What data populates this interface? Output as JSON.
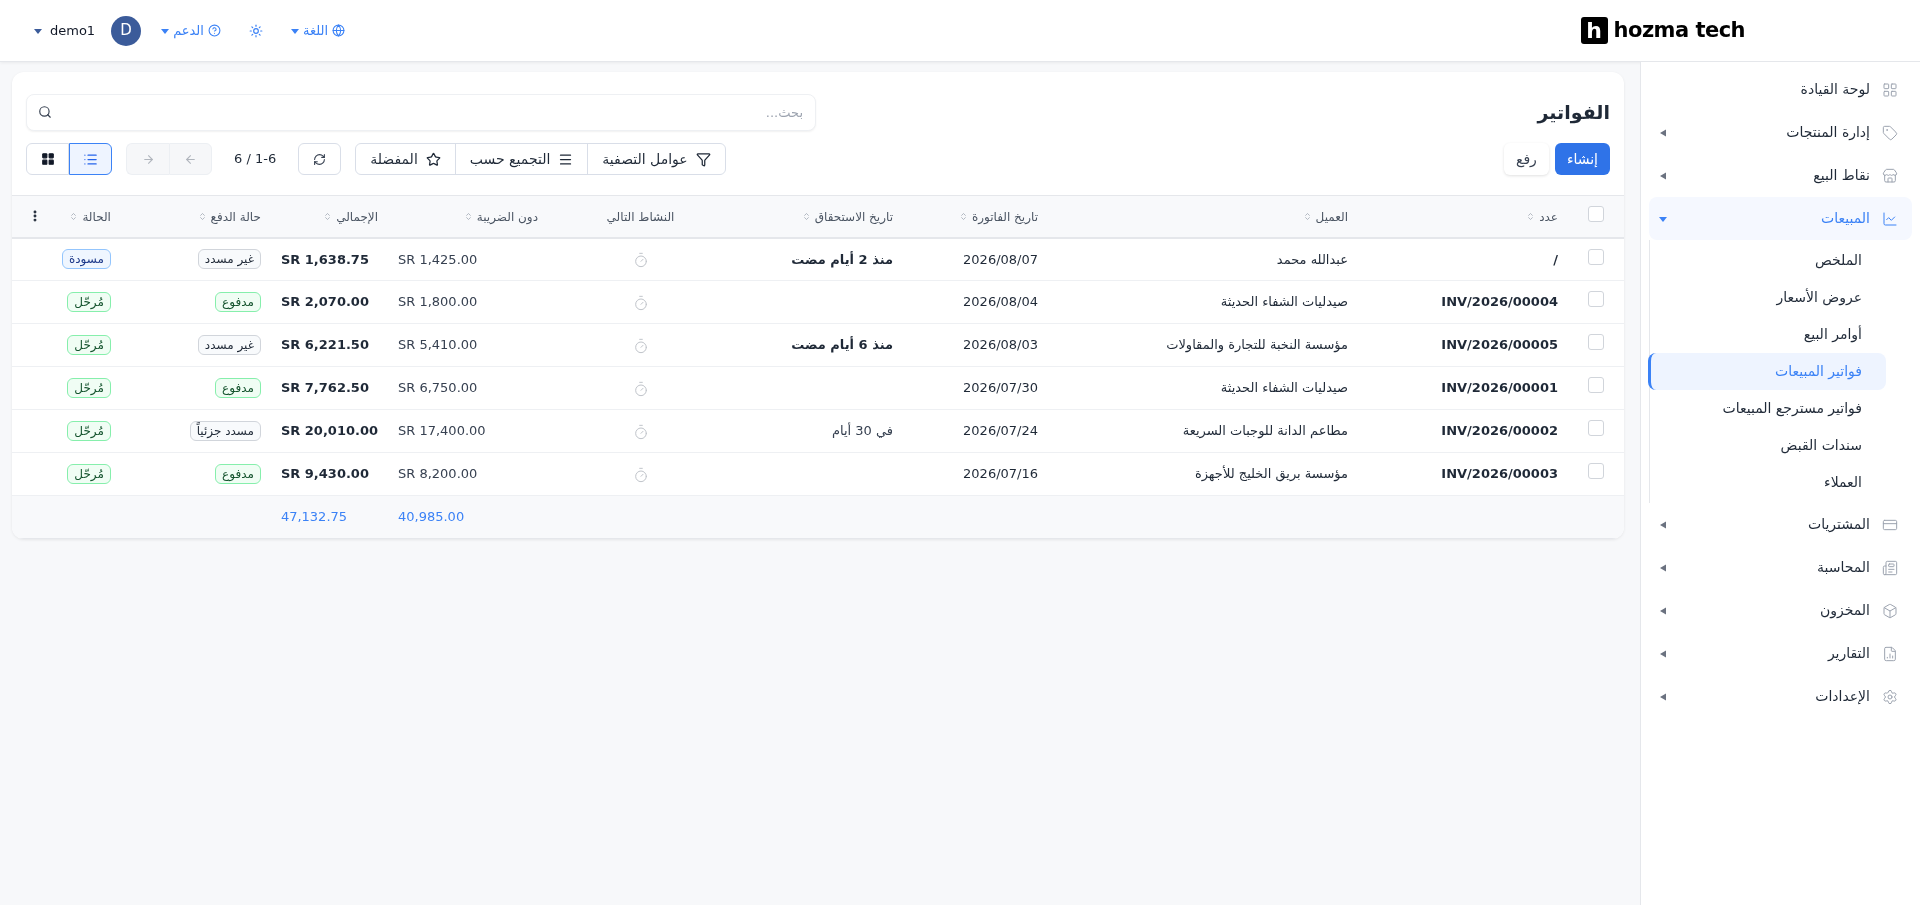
{
  "topbar": {
    "logo": {
      "mark": "h",
      "text": "hozma tech"
    },
    "menus": [
      {
        "kind": "language",
        "label": "اللغة"
      },
      {
        "kind": "theme"
      },
      {
        "kind": "support",
        "label": "الدعم"
      },
      {
        "kind": "user",
        "avatar": "D",
        "label": "demo1"
      }
    ]
  },
  "sidebar": {
    "items": [
      {
        "kind": "grid",
        "label": "لوحة القيادة",
        "expandable": false,
        "expanded": false
      },
      {
        "kind": "tag",
        "label": "إدارة المنتجات",
        "expandable": true,
        "expanded": false
      },
      {
        "kind": "store",
        "label": "نقاط البيع",
        "expandable": true,
        "expanded": false
      },
      {
        "kind": "chart",
        "label": "المبيعات",
        "expandable": true,
        "expanded": true,
        "children": [
          {
            "label": "الملخص",
            "selected": false
          },
          {
            "label": "عروض الأسعار",
            "selected": false
          },
          {
            "label": "أوامر البيع",
            "selected": false
          },
          {
            "label": "فواتير المبيعات",
            "selected": true
          },
          {
            "label": "فواتير مسترجع المبيعات",
            "selected": false
          },
          {
            "label": "سندات القبض",
            "selected": false
          },
          {
            "label": "العملاء",
            "selected": false
          }
        ]
      },
      {
        "kind": "wallet",
        "label": "المشتريات",
        "expandable": true,
        "expanded": false
      },
      {
        "kind": "ledger",
        "label": "المحاسبة",
        "expandable": true,
        "expanded": false
      },
      {
        "kind": "box",
        "label": "المخزون",
        "expandable": true,
        "expanded": false
      },
      {
        "kind": "report",
        "label": "التقارير",
        "expandable": true,
        "expanded": false
      },
      {
        "kind": "settings",
        "label": "الإعدادات",
        "expandable": true,
        "expanded": false
      }
    ]
  },
  "page": {
    "title": "الفواتير",
    "search": {
      "placeholder": "بحث..."
    },
    "actions": [
      {
        "kind": "primary",
        "label": "إنشاء"
      },
      {
        "kind": "secondary",
        "label": "رفع"
      }
    ],
    "filters": [
      {
        "kind": "filter",
        "label": "عوامل التصفية"
      },
      {
        "kind": "group",
        "label": "التجميع حسب"
      },
      {
        "kind": "favorites",
        "label": "المفضلة"
      }
    ],
    "pager": {
      "text": "6 / 1-6",
      "next_disabled": true,
      "prev_disabled": true
    },
    "views": [
      {
        "kind": "list",
        "selected": true
      },
      {
        "kind": "grid",
        "selected": false
      }
    ]
  },
  "table": {
    "all_checked": false,
    "columns": [
      {
        "label": "عدد",
        "sortable": true
      },
      {
        "label": "العميل",
        "sortable": true
      },
      {
        "label": "تاريخ الفاتورة",
        "sortable": true
      },
      {
        "label": "تاريخ الاستحقاق",
        "sortable": true
      },
      {
        "label": "النشاط التالي",
        "sortable": false
      },
      {
        "label": "دون الضريبة",
        "sortable": true
      },
      {
        "label": "الإجمالي",
        "sortable": true
      },
      {
        "label": "حالة الدفع",
        "sortable": true
      },
      {
        "label": "الحالة",
        "sortable": true
      }
    ],
    "rows": [
      {
        "checked": false,
        "number": "/",
        "customer": "عبدالله محمد",
        "invoice_date": "2026/08/07",
        "due": {
          "text": "منذ 2 أيام مضت",
          "overdue": true
        },
        "untaxed": "SR 1,425.00",
        "total": "SR 1,638.75",
        "payment": {
          "text": "غير مسدد",
          "kind": "neutral"
        },
        "status": {
          "text": "مسودة",
          "kind": "info"
        }
      },
      {
        "checked": false,
        "number": "INV/2026/00004",
        "customer": "صيدليات الشفاء الحديثة",
        "invoice_date": "2026/08/04",
        "untaxed": "SR 1,800.00",
        "total": "SR 2,070.00",
        "payment": {
          "text": "مدفوع",
          "kind": "success"
        },
        "status": {
          "text": "مُرحّل",
          "kind": "success"
        }
      },
      {
        "checked": false,
        "number": "INV/2026/00005",
        "customer": "مؤسسة النخبة للتجارة والمقاولات",
        "invoice_date": "2026/08/03",
        "due": {
          "text": "منذ 6 أيام مضت",
          "overdue": true
        },
        "untaxed": "SR 5,410.00",
        "total": "SR 6,221.50",
        "payment": {
          "text": "غير مسدد",
          "kind": "neutral"
        },
        "status": {
          "text": "مُرحّل",
          "kind": "success"
        }
      },
      {
        "checked": false,
        "number": "INV/2026/00001",
        "customer": "صيدليات الشفاء الحديثة",
        "invoice_date": "2026/07/30",
        "untaxed": "SR 6,750.00",
        "total": "SR 7,762.50",
        "payment": {
          "text": "مدفوع",
          "kind": "success"
        },
        "status": {
          "text": "مُرحّل",
          "kind": "success"
        }
      },
      {
        "checked": false,
        "number": "INV/2026/00002",
        "customer": "مطاعم الدانة للوجبات السريعة",
        "invoice_date": "2026/07/24",
        "due": {
          "text": "في 30 أيام",
          "overdue": false
        },
        "untaxed": "SR 17,400.00",
        "total": "SR 20,010.00",
        "payment": {
          "text": "مسدد جزئياً",
          "kind": "neutral"
        },
        "status": {
          "text": "مُرحّل",
          "kind": "success"
        }
      },
      {
        "checked": false,
        "number": "INV/2026/00003",
        "customer": "مؤسسة بريق الخليج للأجهزة",
        "invoice_date": "2026/07/16",
        "untaxed": "SR 8,200.00",
        "total": "SR 9,430.00",
        "payment": {
          "text": "مدفوع",
          "kind": "success"
        },
        "status": {
          "text": "مُرحّل",
          "kind": "success"
        }
      }
    ],
    "totals": {
      "untaxed": "40,985.00",
      "total": "47,132.75"
    }
  }
}
